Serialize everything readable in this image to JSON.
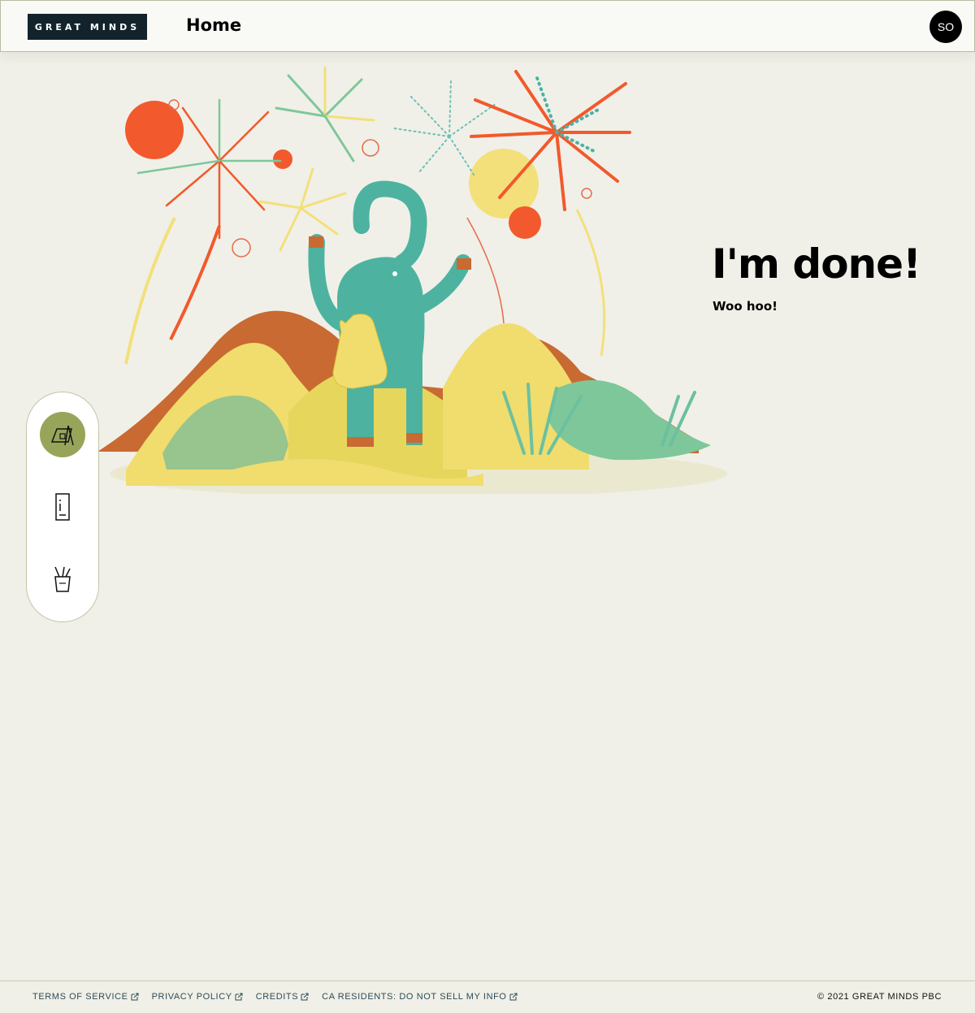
{
  "header": {
    "logo_text": "GREAT MINDS",
    "title": "Home",
    "avatar_initials": "SO"
  },
  "main": {
    "heading": "I'm done!",
    "subheading": "Woo hoo!",
    "illustration_icon": "elephant-celebration-illustration"
  },
  "toolbar": {
    "tools": [
      {
        "icon": "easel-icon",
        "active": true
      },
      {
        "icon": "locker-icon",
        "active": false
      },
      {
        "icon": "pencil-cup-icon",
        "active": false
      }
    ]
  },
  "footer": {
    "links": [
      "TERMS OF SERVICE",
      "PRIVACY POLICY",
      "CREDITS",
      "CA RESIDENTS: DO NOT SELL MY INFO"
    ],
    "external_icon": "external-link-icon",
    "copyright": "© 2021 GREAT MINDS PBC"
  },
  "colors": {
    "background": "#f0f0e8",
    "logo_bg": "#13232b",
    "active_tool": "#97a55a",
    "link": "#2d4a57"
  }
}
